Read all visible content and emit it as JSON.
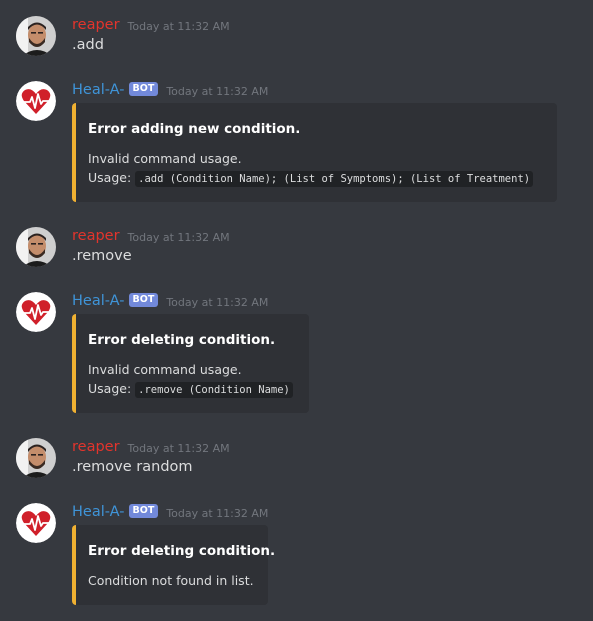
{
  "messages": [
    {
      "author": "reaper",
      "timestamp": "Today at 11:32 AM",
      "text": ".add"
    },
    {
      "author": "Heal-A-",
      "badge": "BOT",
      "timestamp": "Today at 11:32 AM",
      "embed": {
        "accent_color": "#f0b132",
        "title": "Error adding new condition.",
        "line1": "Invalid command usage.",
        "line2_prefix": "Usage:",
        "line2_code": ".add (Condition Name); (List of Symptoms); (List of Treatment)"
      }
    },
    {
      "author": "reaper",
      "timestamp": "Today at 11:32 AM",
      "text": ".remove"
    },
    {
      "author": "Heal-A-",
      "badge": "BOT",
      "timestamp": "Today at 11:32 AM",
      "embed": {
        "accent_color": "#f0b132",
        "title": "Error deleting condition.",
        "line1": "Invalid command usage.",
        "line2_prefix": "Usage:",
        "line2_code": ".remove (Condition Name)"
      }
    },
    {
      "author": "reaper",
      "timestamp": "Today at 11:32 AM",
      "text": ".remove random"
    },
    {
      "author": "Heal-A-",
      "badge": "BOT",
      "timestamp": "Today at 11:32 AM",
      "embed": {
        "accent_color": "#f0b132",
        "title": "Error deleting condition.",
        "line1": "Condition not found in list."
      }
    }
  ],
  "colors": {
    "background": "#36393f",
    "embed_background": "#2f3136",
    "user_name": "#e3342c",
    "bot_name": "#3f94d8",
    "bot_badge": "#7289da",
    "timestamp": "#72767d",
    "embed_accent": "#f0b132"
  },
  "icons": {
    "user_avatar": "user-photo-avatar",
    "bot_avatar": "heart-pulse-logo-avatar"
  }
}
